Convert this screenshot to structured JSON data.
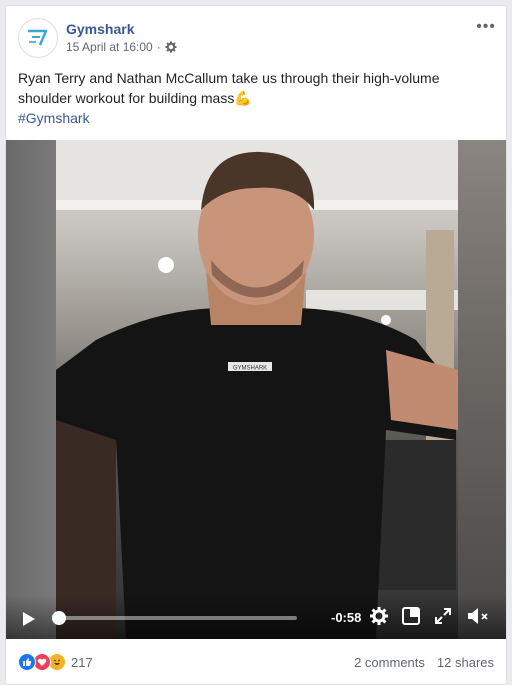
{
  "post": {
    "page_name": "Gymshark",
    "timestamp": "15 April at 16:00",
    "separator": "·",
    "text": "Ryan Terry and Nathan McCallum take us through their high-volume shoulder workout for building mass",
    "emoji": "💪",
    "hashtag": "#Gymshark",
    "more_label": "•••"
  },
  "video": {
    "shirt_logo": "GYMSHARK",
    "time_remaining": "-0:58",
    "progress": 0.02
  },
  "reactions": {
    "count": "217",
    "icons": [
      "like-icon",
      "love-icon",
      "haha-icon"
    ]
  },
  "stats": {
    "comments": "2 comments",
    "shares": "12 shares"
  },
  "colors": {
    "link": "#385898",
    "like": "#1877f2",
    "love": "#f33e58",
    "haha": "#f7b125"
  }
}
